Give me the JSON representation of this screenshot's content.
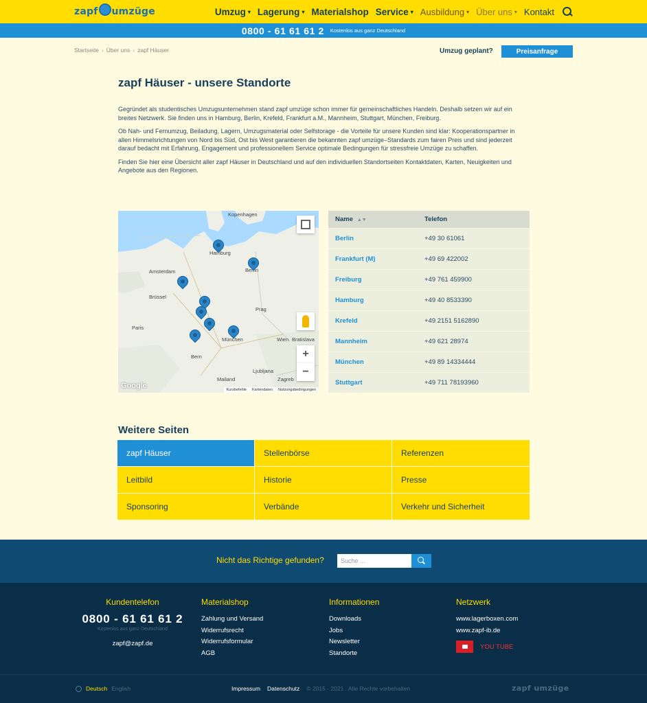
{
  "header": {
    "logo_text_left": "zapf",
    "logo_text_right": "umzüge",
    "nav": [
      {
        "label": "Umzug",
        "chevron": true,
        "style": "bold"
      },
      {
        "label": "Lagerung",
        "chevron": true,
        "style": "bold"
      },
      {
        "label": "Materialshop",
        "chevron": false,
        "style": "bold"
      },
      {
        "label": "Service",
        "chevron": true,
        "style": "bold"
      },
      {
        "label": "Ausbildung",
        "chevron": true,
        "style": "light"
      },
      {
        "label": "Über uns",
        "chevron": true,
        "style": "active"
      },
      {
        "label": "Kontakt",
        "chevron": false,
        "style": "plain"
      }
    ],
    "phone": "0800 - 61 61 61 2",
    "phone_sub": "Kostenlos aus ganz Deutschland"
  },
  "breadcrumb": [
    "Startseite",
    "Über uns",
    "zapf Häuser"
  ],
  "cta": {
    "question": "Umzug geplant?",
    "button": "Preisanfrage"
  },
  "main": {
    "title": "zapf Häuser - unsere Standorte",
    "paragraphs": [
      "Gegründet als studentisches Umzugsunternehmen stand zapf umzüge schon immer für gemeinschaftliches Handeln. Deshalb setzen wir auf ein breites Netzwerk. Sie finden uns in Hamburg, Berlin, Krefeld, Frankfurt a.M., Mannheim, Stuttgart, München, Freiburg.",
      "Ob Nah- und Fernumzug, Beiladung, Lagern, Umzugsmaterial oder Selfstorage - die Vorteile für unsere Kunden sind klar: Kooperationspartner in allen Himmelsrichtungen von Nord bis Süd, Ost bis West garantieren die bekannten zapf umzüge–Standards zum fairen Preis und sind jederzeit darauf bedacht mit Erfahrung, Engagement und professionellem Service optimale Bedingungen für stressfreie Umzüge zu schaffen.",
      "Finden Sie hier eine Übersicht aller zapf Häuser in Deutschland und auf den individuellen Standortseiten Kontaktdaten, Karten, Neuigkeiten und Angebote aus den Regionen."
    ]
  },
  "map": {
    "labels": [
      "Kopenhagen",
      "Hamburg",
      "Berlin",
      "Amsterdam",
      "Brüssel",
      "Paris",
      "Prag",
      "München",
      "Wien",
      "Bratislava",
      "Bern",
      "Mailand",
      "Ljubljana",
      "Zagreb"
    ],
    "google": "Google",
    "attribution": [
      "Kurzbefehle",
      "Kartendaten",
      "Nutzungsbedingungen"
    ],
    "zoom_in": "+",
    "zoom_out": "−"
  },
  "table": {
    "headers": [
      "Name",
      "Telefon"
    ],
    "rows": [
      {
        "city": "Berlin",
        "phone": "+49 30 61061"
      },
      {
        "city": "Frankfurt (M)",
        "phone": "+49 69 422002"
      },
      {
        "city": "Freiburg",
        "phone": "+49 761 459900"
      },
      {
        "city": "Hamburg",
        "phone": "+49 40 8533390"
      },
      {
        "city": "Krefeld",
        "phone": "+49 2151 5162890"
      },
      {
        "city": "Mannheim",
        "phone": "+49 621 28974"
      },
      {
        "city": "München",
        "phone": "+49 89 14334444"
      },
      {
        "city": "Stuttgart",
        "phone": "+49 711 78193960"
      }
    ]
  },
  "more": {
    "title": "Weitere Seiten",
    "items": [
      "zapf Häuser",
      "Stellenbörse",
      "Referenzen",
      "Leitbild",
      "Historie",
      "Presse",
      "Sponsoring",
      "Verbände",
      "Verkehr und Sicherheit"
    ]
  },
  "search": {
    "question": "Nicht das Richtige gefunden?",
    "placeholder": "Suche ..."
  },
  "footer": {
    "col1": {
      "title": "Kundentelefon",
      "phone": "0800 - 61 61 61 2",
      "phone_sub": "Kostenlos aus ganz Deutschland",
      "email": "zapf@zapf.de"
    },
    "col2": {
      "title": "Materialshop",
      "links": [
        "Zahlung und Versand",
        "Widerrufsrecht",
        "Widerrufsformular",
        "AGB"
      ]
    },
    "col3": {
      "title": "Informationen",
      "links": [
        "Downloads",
        "Jobs",
        "Newsletter",
        "Standorte"
      ]
    },
    "col4": {
      "title": "Netzwerk",
      "links": [
        "www.lagerboxen.com",
        "www.zapf-ib.de"
      ],
      "youtube": "YOU TUBE"
    },
    "lang": {
      "active": "Deutsch",
      "other": "English"
    },
    "bottom_links": [
      "Impressum",
      "Datenschutz"
    ],
    "copyright": "© 2015 - 2021 . Alle Rechte vorbehalten",
    "logo": "zapf umzüge"
  },
  "colors": {
    "yellow": "#ffdd00",
    "blue": "#1f8fd6",
    "navy": "#0a2e47",
    "background": "#fffbe0"
  }
}
